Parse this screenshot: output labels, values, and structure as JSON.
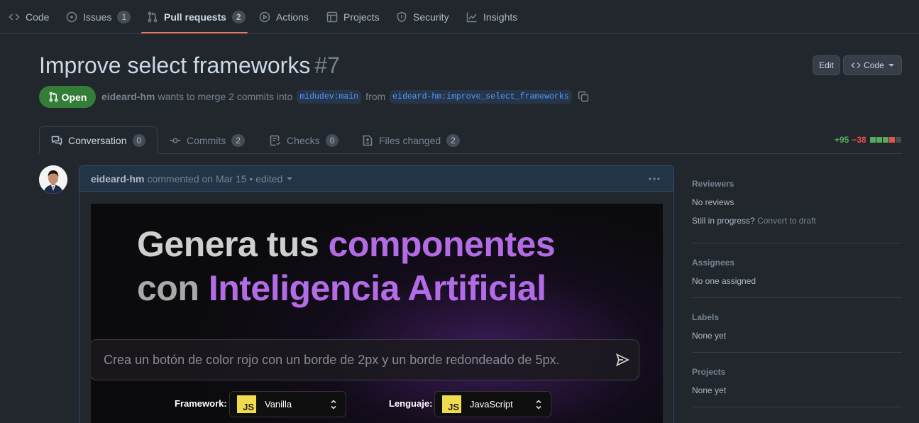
{
  "repo_nav": {
    "items": [
      {
        "label": "Code"
      },
      {
        "label": "Issues",
        "count": "1"
      },
      {
        "label": "Pull requests",
        "count": "2"
      },
      {
        "label": "Actions"
      },
      {
        "label": "Projects"
      },
      {
        "label": "Security"
      },
      {
        "label": "Insights"
      }
    ]
  },
  "pr": {
    "title": "Improve select frameworks",
    "number": "#7",
    "state": "Open",
    "author": "eideard-hm",
    "merge_text": "wants to merge 2 commits into",
    "base_branch": "midudev:main",
    "from_text": "from",
    "head_branch": "eideard-hm:improve_select_frameworks",
    "edit_label": "Edit",
    "code_label": "Code"
  },
  "tabs": [
    {
      "label": "Conversation",
      "count": "0"
    },
    {
      "label": "Commits",
      "count": "2"
    },
    {
      "label": "Checks",
      "count": "0"
    },
    {
      "label": "Files changed",
      "count": "2"
    }
  ],
  "diffstat": {
    "additions": "+95",
    "deletions": "−38",
    "colors": {
      "add": "#57ab5a",
      "del": "#e5534b",
      "neutral": "#444c56"
    }
  },
  "comment": {
    "author": "eideard-hm",
    "meta": "commented on Mar 15 • edited"
  },
  "hero": {
    "line1_a": "Genera tus",
    "line1_b": "componentes",
    "line2_a": "con",
    "line2_b": "Inteligencia Artificial",
    "prompt": "Crea un botón de color rojo con un borde de 2px y un borde redondeado de 5px.",
    "framework_label": "Framework:",
    "framework_value": "Vanilla",
    "language_label": "Lenguaje:",
    "language_value": "JavaScript",
    "js_badge": "JS"
  },
  "sidebar": {
    "reviewers_title": "Reviewers",
    "reviewers_value": "No reviews",
    "progress_text": "Still in progress?",
    "progress_link": "Convert to draft",
    "assignees_title": "Assignees",
    "assignees_value": "No one assigned",
    "labels_title": "Labels",
    "labels_value": "None yet",
    "projects_title": "Projects",
    "projects_value": "None yet"
  },
  "colors": {
    "accent": "#ec775c",
    "open_green": "#347d39",
    "link_blue": "#539bf5",
    "hero_purple": "#b46be6"
  }
}
